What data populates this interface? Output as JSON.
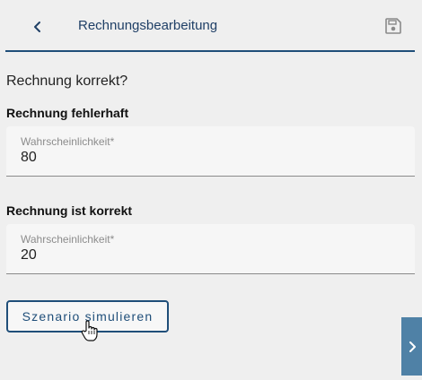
{
  "header": {
    "title": "Rechnungsbearbeitung",
    "back_icon": "chevron-left-icon",
    "save_icon": "floppy-disk-icon"
  },
  "question": "Rechnung korrekt?",
  "scenarios": [
    {
      "label": "Rechnung fehlerhaft",
      "field_label": "Wahrscheinlichkeit*",
      "value": "80"
    },
    {
      "label": "Rechnung ist korrekt",
      "field_label": "Wahrscheinlichkeit*",
      "value": "20"
    }
  ],
  "simulate_button": {
    "label": "Szenario simulieren"
  },
  "side_toggle": {
    "icon": "chevron-right-icon"
  },
  "colors": {
    "accent": "#1f4e79",
    "background": "#efefef",
    "side_toggle": "#4f81a6",
    "field_bg": "#f6f6f6"
  }
}
